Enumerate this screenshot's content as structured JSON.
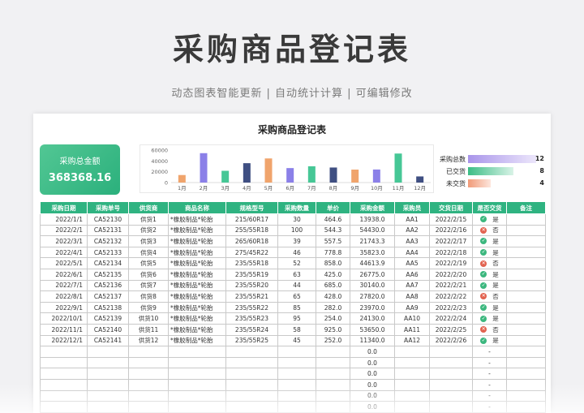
{
  "header": {
    "title": "采购商品登记表",
    "subtitle": "动态图表智能更新 | 自动统计计算 | 可编辑修改"
  },
  "sheet": {
    "title": "采购商品登记表",
    "total_label": "采购总金额",
    "total_value": "368368.16"
  },
  "status": [
    {
      "label": "采购总数",
      "count": "12",
      "value": 12,
      "color_from": "#a995ea",
      "color_to": "#ece6fb"
    },
    {
      "label": "已交货",
      "count": "8",
      "value": 8,
      "color_from": "#3cbd86",
      "color_to": "#d9f3e7"
    },
    {
      "label": "未交货",
      "count": "4",
      "value": 4,
      "color_from": "#f09a78",
      "color_to": "#fde6dd"
    }
  ],
  "chart_data": {
    "type": "bar",
    "categories": [
      "1月",
      "2月",
      "3月",
      "4月",
      "5月",
      "6月",
      "7月",
      "8月",
      "9月",
      "10月",
      "11月",
      "12月"
    ],
    "values": [
      13938.0,
      54333.8,
      21743.3,
      35823.0,
      44613.9,
      26775.0,
      30140.0,
      27820.0,
      23970.0,
      24130.0,
      53650.0,
      11340.0
    ],
    "colors": [
      "#f0a46c",
      "#8b80e8",
      "#46c796",
      "#3f4f82",
      "#f0a46c",
      "#8b80e8",
      "#46c796",
      "#3f4f82",
      "#f0a46c",
      "#8b80e8",
      "#46c796",
      "#3f4f82"
    ],
    "y_ticks": [
      "60000",
      "40000",
      "20000",
      "0"
    ],
    "ylim": [
      0,
      60000
    ],
    "grid": false,
    "legend": false
  },
  "table": {
    "headers": [
      "采购日期",
      "采购单号",
      "供货商",
      "商品名称",
      "规格型号",
      "采购数量",
      "单价",
      "采购金额",
      "采购员",
      "交货日期",
      "是否交货",
      "备注"
    ],
    "rows": [
      {
        "date": "2022/1/1",
        "order": "CA52130",
        "supplier": "供货1",
        "product": "*橡胶制品*轮胎",
        "spec": "215/60R17",
        "qty": "30",
        "price": "464.6",
        "amount": "13938.0",
        "buyer": "AA1",
        "delivery": "2022/2/15",
        "delivered": "是",
        "note": ""
      },
      {
        "date": "2022/2/1",
        "order": "CA52131",
        "supplier": "供货2",
        "product": "*橡胶制品*轮胎",
        "spec": "255/55R18",
        "qty": "100",
        "price": "544.3",
        "amount": "54430.0",
        "buyer": "AA2",
        "delivery": "2022/2/16",
        "delivered": "否",
        "note": ""
      },
      {
        "date": "2022/3/1",
        "order": "CA52132",
        "supplier": "供货3",
        "product": "*橡胶制品*轮胎",
        "spec": "265/60R18",
        "qty": "39",
        "price": "557.5",
        "amount": "21743.3",
        "buyer": "AA3",
        "delivery": "2022/2/17",
        "delivered": "是",
        "note": ""
      },
      {
        "date": "2022/4/1",
        "order": "CA52133",
        "supplier": "供货4",
        "product": "*橡胶制品*轮胎",
        "spec": "275/45R22",
        "qty": "46",
        "price": "778.8",
        "amount": "35823.0",
        "buyer": "AA4",
        "delivery": "2022/2/18",
        "delivered": "是",
        "note": ""
      },
      {
        "date": "2022/5/1",
        "order": "CA52134",
        "supplier": "供货5",
        "product": "*橡胶制品*轮胎",
        "spec": "235/55R18",
        "qty": "52",
        "price": "858.0",
        "amount": "44613.9",
        "buyer": "AA5",
        "delivery": "2022/2/19",
        "delivered": "否",
        "note": ""
      },
      {
        "date": "2022/6/1",
        "order": "CA52135",
        "supplier": "供货6",
        "product": "*橡胶制品*轮胎",
        "spec": "235/55R19",
        "qty": "63",
        "price": "425.0",
        "amount": "26775.0",
        "buyer": "AA6",
        "delivery": "2022/2/20",
        "delivered": "是",
        "note": ""
      },
      {
        "date": "2022/7/1",
        "order": "CA52136",
        "supplier": "供货7",
        "product": "*橡胶制品*轮胎",
        "spec": "235/55R20",
        "qty": "44",
        "price": "685.0",
        "amount": "30140.0",
        "buyer": "AA7",
        "delivery": "2022/2/21",
        "delivered": "是",
        "note": ""
      },
      {
        "date": "2022/8/1",
        "order": "CA52137",
        "supplier": "供货8",
        "product": "*橡胶制品*轮胎",
        "spec": "235/55R21",
        "qty": "65",
        "price": "428.0",
        "amount": "27820.0",
        "buyer": "AA8",
        "delivery": "2022/2/22",
        "delivered": "否",
        "note": ""
      },
      {
        "date": "2022/9/1",
        "order": "CA52138",
        "supplier": "供货9",
        "product": "*橡胶制品*轮胎",
        "spec": "235/55R22",
        "qty": "85",
        "price": "282.0",
        "amount": "23970.0",
        "buyer": "AA9",
        "delivery": "2022/2/23",
        "delivered": "是",
        "note": ""
      },
      {
        "date": "2022/10/1",
        "order": "CA52139",
        "supplier": "供货10",
        "product": "*橡胶制品*轮胎",
        "spec": "235/55R23",
        "qty": "95",
        "price": "254.0",
        "amount": "24130.0",
        "buyer": "AA10",
        "delivery": "2022/2/24",
        "delivered": "是",
        "note": ""
      },
      {
        "date": "2022/11/1",
        "order": "CA52140",
        "supplier": "供货11",
        "product": "*橡胶制品*轮胎",
        "spec": "235/55R24",
        "qty": "58",
        "price": "925.0",
        "amount": "53650.0",
        "buyer": "AA11",
        "delivery": "2022/2/25",
        "delivered": "否",
        "note": ""
      },
      {
        "date": "2022/12/1",
        "order": "CA52141",
        "supplier": "供货12",
        "product": "*橡胶制品*轮胎",
        "spec": "235/55R25",
        "qty": "45",
        "price": "252.0",
        "amount": "11340.0",
        "buyer": "AA12",
        "delivery": "2022/2/26",
        "delivered": "是",
        "note": ""
      }
    ],
    "empty_rows": [
      {
        "amount": "0.0",
        "delivered": "-"
      },
      {
        "amount": "0.0",
        "delivered": "-"
      },
      {
        "amount": "0.0",
        "delivered": "-"
      },
      {
        "amount": "0.0",
        "delivered": "-"
      },
      {
        "amount": "0.0",
        "delivered": "-"
      },
      {
        "amount": "0.0",
        "delivered": "-"
      }
    ]
  }
}
